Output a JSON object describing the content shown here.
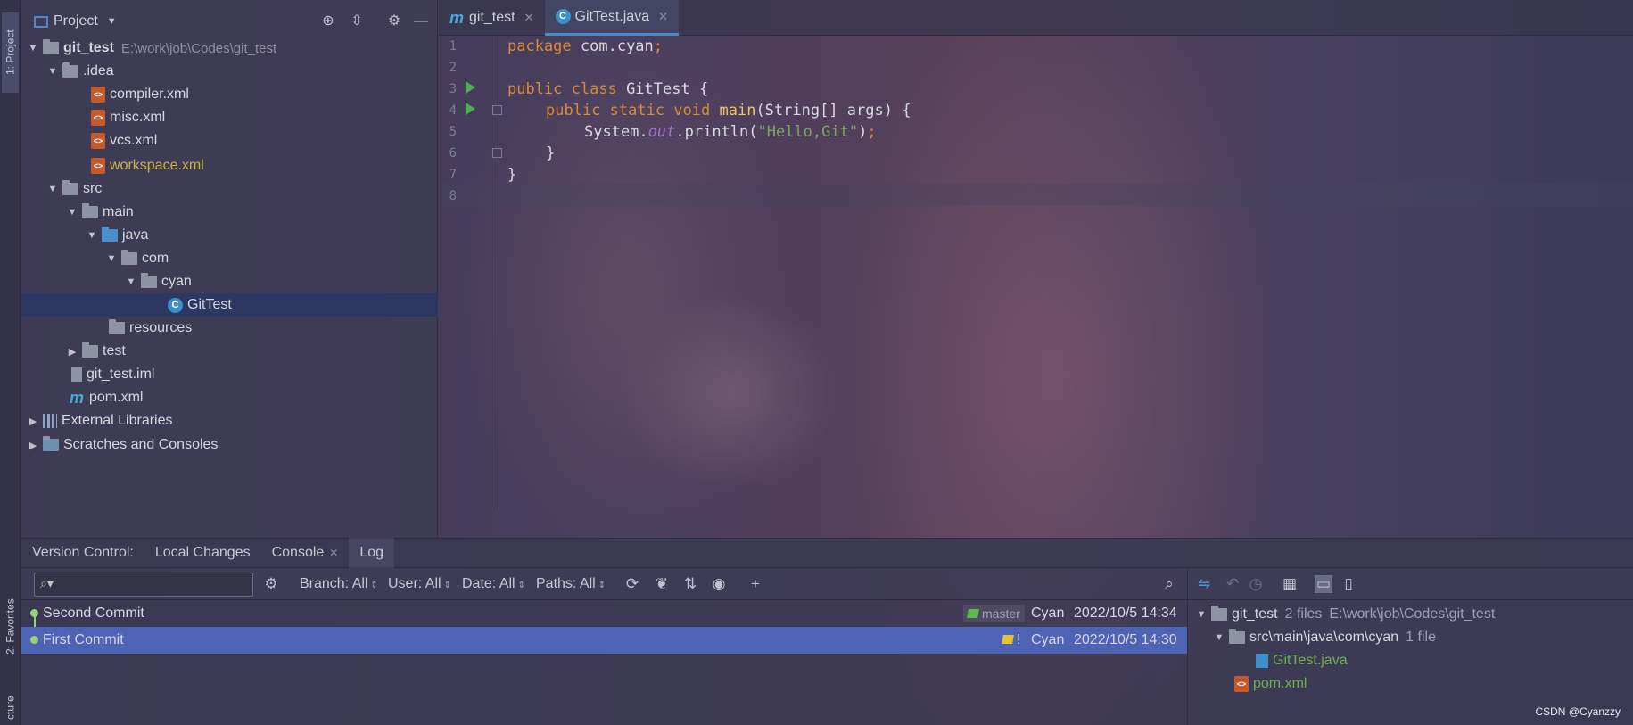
{
  "sidebar_tabs": {
    "project": "1: Project",
    "favorites": "2: Favorites",
    "structure": "cture"
  },
  "project_panel": {
    "title": "Project",
    "tree": [
      {
        "label": "git_test",
        "hint": "E:\\work\\job\\Codes\\git_test"
      },
      {
        "label": ".idea"
      },
      {
        "label": "compiler.xml"
      },
      {
        "label": "misc.xml"
      },
      {
        "label": "vcs.xml"
      },
      {
        "label": "workspace.xml"
      },
      {
        "label": "src"
      },
      {
        "label": "main"
      },
      {
        "label": "java"
      },
      {
        "label": "com"
      },
      {
        "label": "cyan"
      },
      {
        "label": "GitTest"
      },
      {
        "label": "resources"
      },
      {
        "label": "test"
      },
      {
        "label": "git_test.iml"
      },
      {
        "label": "pom.xml"
      },
      {
        "label": "External Libraries"
      },
      {
        "label": "Scratches and Consoles"
      }
    ]
  },
  "editor": {
    "tabs": [
      {
        "label": "git_test"
      },
      {
        "label": "GitTest.java"
      }
    ],
    "line_numbers": [
      "1",
      "2",
      "3",
      "4",
      "5",
      "6",
      "7",
      "8"
    ],
    "code": {
      "l1_kw": "package",
      "l1_rest": " com.cyan",
      "l1_semi": ";",
      "l3_kw": "public class",
      "l3_rest": " GitTest {",
      "l4_kw": "public static void",
      "l4_fn": "main",
      "l4_rest": "(String[] args) {",
      "l5_a": "System.",
      "l5_field": "out",
      "l5_b": ".println(",
      "l5_str": "\"Hello,Git\"",
      "l5_c": ")",
      "l5_semi": ";",
      "l6": "}",
      "l7": "}"
    }
  },
  "version_control": {
    "label": "Version Control:",
    "tabs": [
      {
        "label": "Local Changes"
      },
      {
        "label": "Console"
      },
      {
        "label": "Log"
      }
    ]
  },
  "log_toolbar": {
    "search_placeholder": "",
    "filters": {
      "branch": "Branch: All",
      "user": "User: All",
      "date": "Date: All",
      "paths": "Paths: All"
    }
  },
  "commits": [
    {
      "message": "Second Commit",
      "branch": "master",
      "author": "Cyan",
      "date": "2022/10/5 14:34"
    },
    {
      "message": "First Commit",
      "tag": "!",
      "author": "Cyan",
      "date": "2022/10/5 14:30"
    }
  ],
  "changes": {
    "root": "git_test",
    "root_info": "2 files",
    "root_path": "E:\\work\\job\\Codes\\git_test",
    "dir": "src\\main\\java\\com\\cyan",
    "dir_info": "1 file",
    "file1": "GitTest.java",
    "file2": "pom.xml"
  },
  "watermark": "CSDN @Cyanzzy",
  "colors": {
    "selection": "#2c3862",
    "commit_selected": "#4d63b5",
    "keyword": "#d88a35",
    "string": "#7ca562",
    "modified_file": "#6fb04f"
  }
}
